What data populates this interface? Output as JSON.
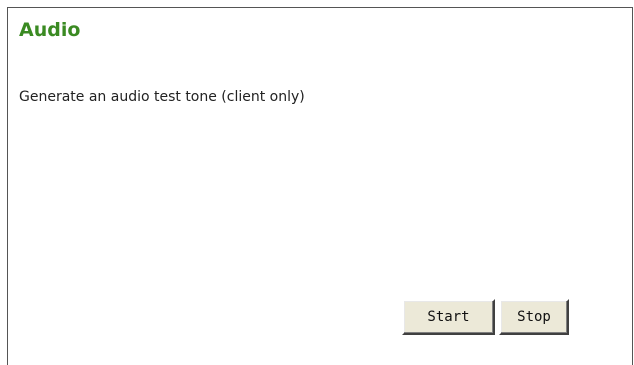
{
  "section": {
    "title": "Audio",
    "description": "Generate an audio test tone (client only)"
  },
  "buttons": {
    "start_label": "Start",
    "stop_label": "Stop"
  },
  "colors": {
    "title": "#3a8a22",
    "button_face": "#ece9d8"
  }
}
